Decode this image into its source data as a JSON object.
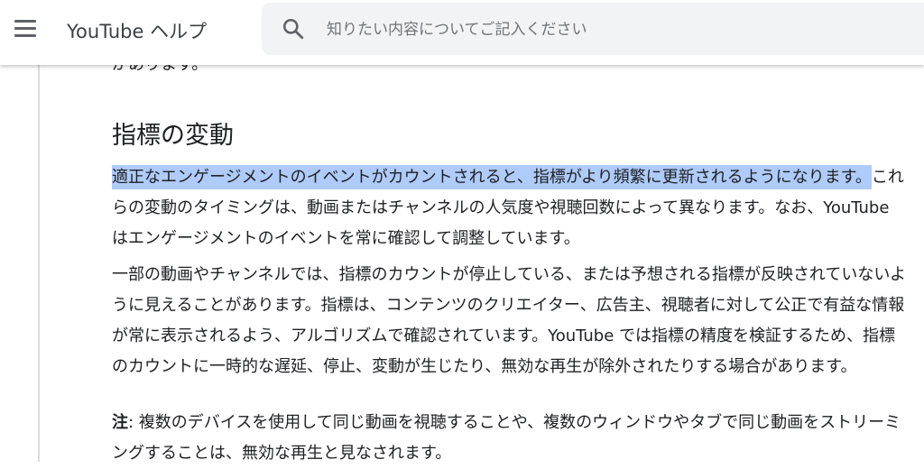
{
  "header": {
    "menu_icon": "hamburger-menu-icon",
    "title": "YouTube ヘルプ",
    "search_icon": "search-icon",
    "search_placeholder": "知りたい内容についてご記入ください"
  },
  "article": {
    "truncated_line": "があります。",
    "section_heading": "指標の変動",
    "p1_highlighted": "適正なエンゲージメントのイベントがカウントされると、指標がより頻繁に更新されるようになります。",
    "p1_rest": "これらの変動のタイミングは、動画またはチャンネルの人気度や視聴回数によって異なります。なお、YouTube はエンゲージメントのイベントを常に確認して調整しています。",
    "p2": "一部の動画やチャンネルでは、指標のカウントが停止している、または予想される指標が反映されていないように見えることがあります。指標は、コンテンツのクリエイター、広告主、視聴者に対して公正で有益な情報が常に表示されるよう、アルゴリズムで確認されています。YouTube では指標の精度を検証するため、指標のカウントに一時的な遅延、停止、変動が生じたり、無効な再生が除外されたりする場合があります。",
    "note_label": "注",
    "note_text": ": 複数のデバイスを使用して同じ動画を視聴することや、複数のウィンドウやタブで同じ動画をストリーミングすることは、無効な再生と見なされます。"
  },
  "colors": {
    "highlight": "#aecbfa",
    "text": "#202124",
    "search_bg": "#f1f3f4"
  }
}
